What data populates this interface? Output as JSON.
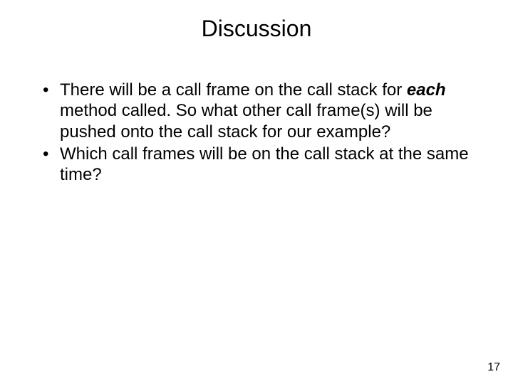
{
  "title": "Discussion",
  "bullets": [
    {
      "pre": "There will be a call frame on the call stack for ",
      "emph": "each",
      "post": " method called. So what other call frame(s) will be pushed onto the call stack for our example?"
    },
    {
      "pre": "Which call frames will be on the call stack at the same time?",
      "emph": "",
      "post": ""
    }
  ],
  "page_number": "17"
}
